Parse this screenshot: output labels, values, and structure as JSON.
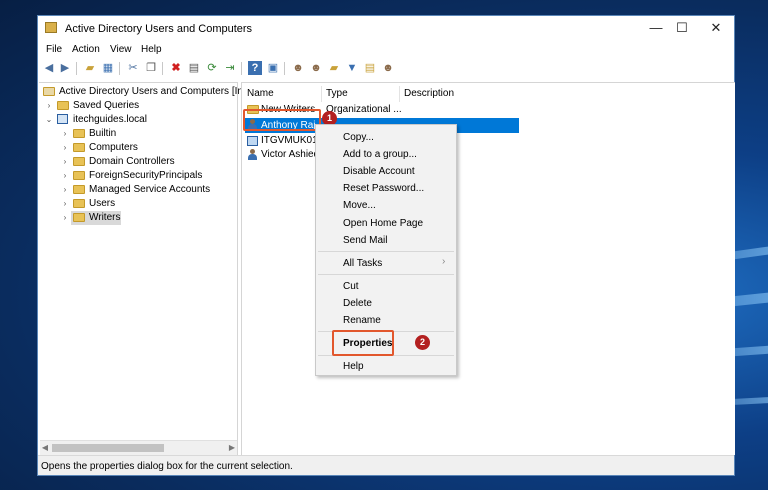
{
  "window": {
    "title": "Active Directory Users and Computers",
    "controls": {
      "minimize": "—",
      "maximize": "☐",
      "close": "✕"
    }
  },
  "menubar": {
    "items": [
      "File",
      "Action",
      "View",
      "Help"
    ]
  },
  "toolbar": {
    "icons": [
      "back-icon",
      "forward-icon",
      "up-folder-icon",
      "console-tree-icon",
      "cut-icon",
      "copy-icon",
      "delete-icon",
      "properties-icon",
      "refresh-icon",
      "export-list-icon",
      "help-icon",
      "show-pane-icon",
      "new-user-icon",
      "new-group-icon",
      "new-ou-icon",
      "filter-icon",
      "find-icon",
      "add-to-group-icon"
    ]
  },
  "tree": {
    "root": "Active Directory Users and Computers [InfoD",
    "saved_queries": "Saved Queries",
    "domain": "itechguides.local",
    "children": [
      "Builtin",
      "Computers",
      "Domain Controllers",
      "ForeignSecurityPrincipals",
      "Managed Service Accounts",
      "Users",
      "Writers"
    ]
  },
  "list": {
    "columns": [
      "Name",
      "Type",
      "Description"
    ],
    "rows": [
      {
        "name": "New Writers",
        "type": "Organizational ...",
        "description": ""
      },
      {
        "name": "Anthony Raj",
        "type": "",
        "description": ""
      },
      {
        "name": "ITGVMUK01",
        "type": "",
        "description": ""
      },
      {
        "name": "Victor Ashiedu",
        "type": "",
        "description": ""
      }
    ]
  },
  "context_menu": {
    "group1": [
      "Copy...",
      "Add to a group...",
      "Disable Account",
      "Reset Password...",
      "Move...",
      "Open Home Page",
      "Send Mail"
    ],
    "all_tasks": "All Tasks",
    "all_tasks_arrow": "›",
    "group3": [
      "Cut",
      "Delete",
      "Rename"
    ],
    "properties": "Properties",
    "help": "Help"
  },
  "annotations": {
    "badge1": "1",
    "badge2": "2"
  },
  "statusbar": {
    "text": "Opens the properties dialog box for the current selection."
  },
  "colors": {
    "selection": "#0078d7",
    "highlight_box": "#e2572d",
    "badge": "#b32020"
  }
}
